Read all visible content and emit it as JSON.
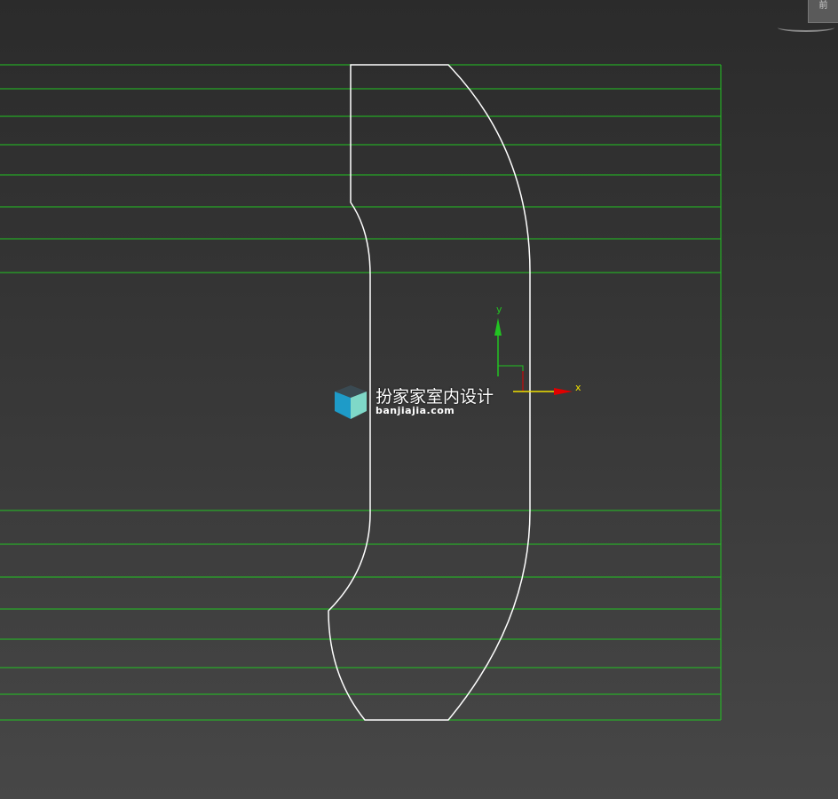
{
  "viewport": {
    "background": "#383838",
    "grid_color": "#22c422",
    "shape_color": "#ffffff"
  },
  "viewcube": {
    "label": "前"
  },
  "gizmo": {
    "x_label": "x",
    "y_label": "y",
    "x_axis_color": "#e00000",
    "y_axis_color": "#22c422",
    "highlight_color": "#f0e000"
  },
  "watermark": {
    "title": "扮家家室内设计",
    "subtitle": "banjiajia.com",
    "logo_icon": "cube-logo-icon"
  }
}
